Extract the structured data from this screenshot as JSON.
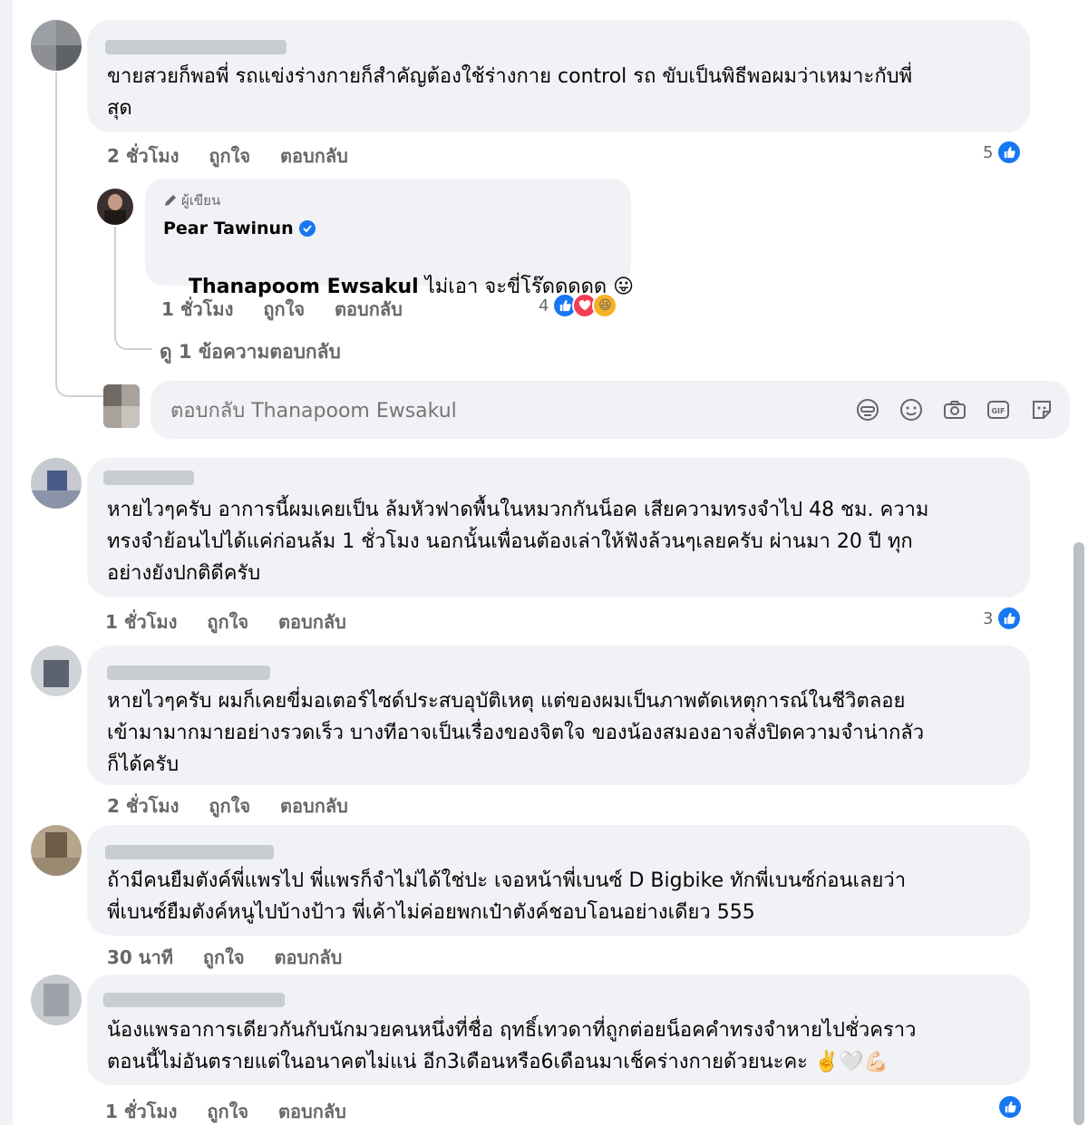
{
  "comments": [
    {
      "text": "ขายสวยก็พอพี่ รถแข่งร่างกายก็สำคัญต้องใช้ร่างกาย control รถ ขับเป็นพิธีพอผมว่าเหมาะกับพี่\nสุด",
      "time": "2 ชั่วโมง",
      "like": "ถูกใจ",
      "reply": "ตอบกลับ",
      "reaction_count": "5"
    },
    {
      "text": "หายไวๆครับ อาการนี้ผมเคยเป็น ล้มหัวฟาดพื้นในหมวกกันน็อค เสียความทรงจำไป 48 ชม. ความ\nทรงจำย้อนไปได้แค่ก่อนล้ม 1 ชั่วโมง นอกนั้นเพื่อนต้องเล่าให้ฟังล้วนๆเลยครับ ผ่านมา 20 ปี ทุก\nอย่างยังปกติดีครับ",
      "time": "1 ชั่วโมง",
      "like": "ถูกใจ",
      "reply": "ตอบกลับ",
      "reaction_count": "3"
    },
    {
      "text": "หายไวๆครับ ผมก็เคยขี่มอเตอร์ไซด์ประสบอุบัติเหตุ แต่ของผมเป็นภาพตัดเหตุการณ์ในชีวิตลอย\nเข้ามามากมายอย่างรวดเร็ว บางทีอาจเป็นเรื่องของจิตใจ ของน้องสมองอาจสั่งปิดความจำน่ากลัว\nก็ได้ครับ",
      "time": "2 ชั่วโมง",
      "like": "ถูกใจ",
      "reply": "ตอบกลับ"
    },
    {
      "text": "ถ้ามีคนยืมตังค์พี่แพรไป พี่แพรก็จำไม่ได้ใช่ปะ เจอหน้าพี่เบนซ์ D Bigbike ทักพี่เบนซ์ก่อนเลยว่า\nพี่เบนซ์ยืมตังค์หนูไปบ้างป้าว พี่เค้าไม่ค่อยพกเป๋าตังค์ชอบโอนอย่างเดียว 555",
      "time": "30 นาที",
      "like": "ถูกใจ",
      "reply": "ตอบกลับ"
    },
    {
      "text": "น้องแพรอาการเดียวกันกับนักมวยคนหนึ่งที่ชื่อ ฤทธิ์เทวดาที่ถูกต่อยน็อคคำทรงจำหายไปชั่วคราว\nตอนนี้ไม่อันตรายแต่ในอนาคตไม่แน่ อีก3เดือนหรือ6เดือนมาเช็คร่างกายด้วยนะคะ ✌️🤍💪🏻",
      "time": "1 ชั่วโมง",
      "like": "ถูกใจ",
      "reply": "ตอบกลับ"
    }
  ],
  "author_reply": {
    "badge": "ผู้เขียน",
    "name": "Pear Tawinun",
    "tagged": "Thanapoom Ewsakul",
    "text": " ไม่เอา จะขี่โร๊ดดดดด 😛",
    "time": "1 ชั่วโมง",
    "like": "ถูกใจ",
    "reply": "ตอบกลับ",
    "reaction_count": "4"
  },
  "view_replies": "ดู 1 ข้อความตอบกลับ",
  "reply_box": {
    "placeholder": "ตอบกลับ Thanapoom Ewsakul"
  },
  "colors": {
    "bubble": "#f0f2f5",
    "like": "#1877f2",
    "love": "#f33e58",
    "muted_text": "#65676b"
  },
  "icons": [
    "avatar-sticker-icon",
    "emoji-icon",
    "camera-icon",
    "gif-icon",
    "sticker-icon",
    "verified-badge-icon",
    "pencil-icon",
    "like-icon",
    "love-icon",
    "haha-icon"
  ]
}
